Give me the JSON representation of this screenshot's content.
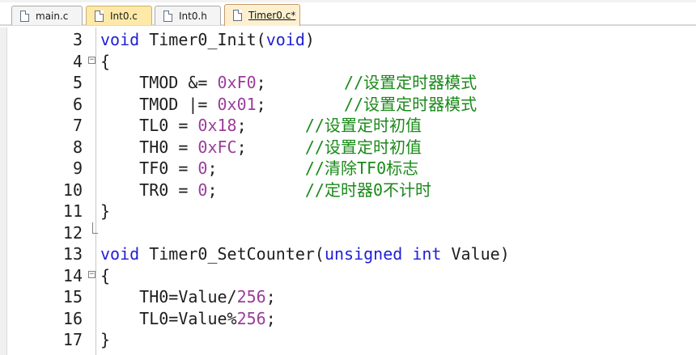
{
  "tabs": [
    {
      "label": "main.c",
      "state": "normal"
    },
    {
      "label": "Int0.c",
      "state": "current"
    },
    {
      "label": "Int0.h",
      "state": "normal"
    },
    {
      "label": "Timer0.c*",
      "state": "active"
    }
  ],
  "editor": {
    "lines": [
      {
        "num": "3",
        "fold": "none",
        "code": "void Timer0_Init(void)"
      },
      {
        "num": "4",
        "fold": "open",
        "code": "{"
      },
      {
        "num": "5",
        "fold": "none",
        "code": "    TMOD &= 0xF0;        //设置定时器模式"
      },
      {
        "num": "6",
        "fold": "none",
        "code": "    TMOD |= 0x01;        //设置定时器模式"
      },
      {
        "num": "7",
        "fold": "none",
        "code": "    TL0 = 0x18;      //设置定时初值"
      },
      {
        "num": "8",
        "fold": "none",
        "code": "    TH0 = 0xFC;      //设置定时初值"
      },
      {
        "num": "9",
        "fold": "none",
        "code": "    TF0 = 0;         //清除TF0标志"
      },
      {
        "num": "10",
        "fold": "none",
        "code": "    TR0 = 0;         //定时器0不计时"
      },
      {
        "num": "11",
        "fold": "none",
        "code": "}"
      },
      {
        "num": "12",
        "fold": "end",
        "code": ""
      },
      {
        "num": "13",
        "fold": "none",
        "code": "void Timer0_SetCounter(unsigned int Value)"
      },
      {
        "num": "14",
        "fold": "open",
        "code": "{"
      },
      {
        "num": "15",
        "fold": "none",
        "code": "    TH0=Value/256;"
      },
      {
        "num": "16",
        "fold": "none",
        "code": "    TL0=Value%256;"
      },
      {
        "num": "17",
        "fold": "none",
        "code": "}"
      }
    ]
  },
  "colors": {
    "keyword": "#1f1fd6",
    "number": "#9a3d9a",
    "comment": "#1a8a1a",
    "text": "#1e1e1e"
  }
}
